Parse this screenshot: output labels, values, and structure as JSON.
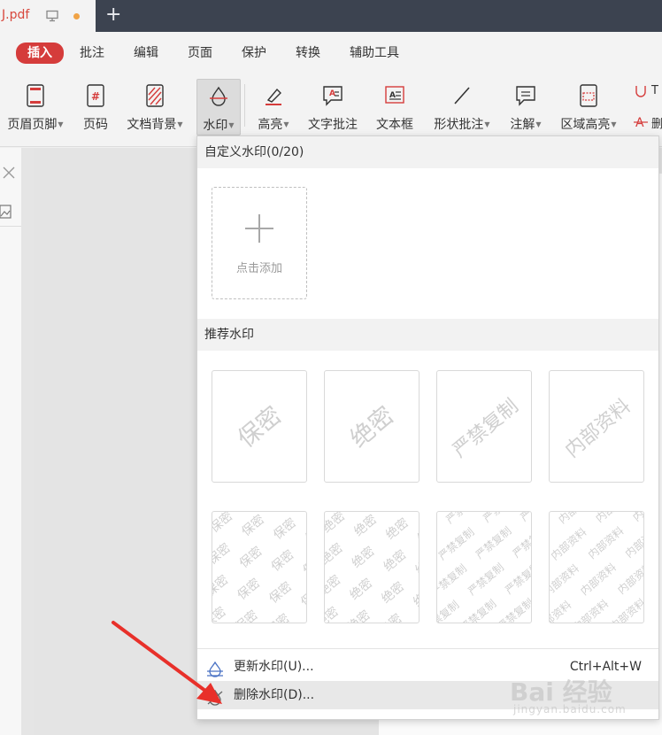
{
  "titlebar": {
    "doc_tab": "J.pdf",
    "new_tab": "+"
  },
  "menu": {
    "items": [
      "插入",
      "批注",
      "编辑",
      "页面",
      "保护",
      "转换",
      "辅助工具"
    ],
    "active": "插入"
  },
  "toolbar": {
    "tools": [
      {
        "label": "页眉页脚",
        "icon": "header-footer-icon"
      },
      {
        "label": "页码",
        "icon": "page-number-icon"
      },
      {
        "label": "文档背景",
        "icon": "document-background-icon"
      },
      {
        "label": "水印",
        "icon": "watermark-icon"
      },
      {
        "label": "高亮",
        "icon": "highlight-icon"
      },
      {
        "label": "文字批注",
        "icon": "text-comment-icon"
      },
      {
        "label": "文本框",
        "icon": "textbox-icon"
      },
      {
        "label": "形状批注",
        "icon": "shape-comment-icon"
      },
      {
        "label": "注解",
        "icon": "annotation-icon"
      },
      {
        "label": "区域高亮",
        "icon": "area-highlight-icon"
      }
    ],
    "partial_right": "T",
    "partial_right_2": "删"
  },
  "dropdown": {
    "custom_header": "自定义水印(0/20)",
    "add_label": "点击添加",
    "recommended_header": "推荐水印",
    "presets": [
      "保密",
      "绝密",
      "严禁复制",
      "内部资料"
    ],
    "update_label": "更新水印(U)...",
    "update_shortcut": "Ctrl+Alt+W",
    "delete_label": "删除水印(D)..."
  },
  "colors": {
    "accent": "#d53c3b",
    "titlebar": "#3c4350",
    "arrow": "#e8302a"
  },
  "watermark_brand": {
    "logo": "Bai 经验",
    "url": "jingyan.baidu.com"
  }
}
